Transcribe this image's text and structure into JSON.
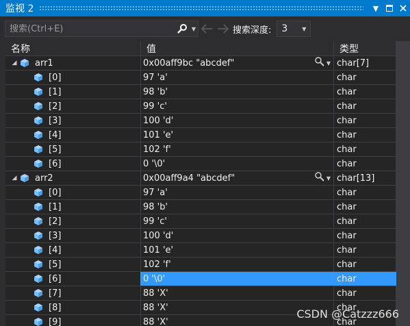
{
  "window": {
    "title": "监视 2"
  },
  "toolbar": {
    "search_placeholder": "搜索(Ctrl+E)",
    "depth_label": "搜索深度:",
    "depth_value": "3"
  },
  "columns": {
    "name": "名称",
    "value": "值",
    "type": "类型"
  },
  "rows": [
    {
      "name": "arr1",
      "value": "0x00aff9bc \"abcdef\"",
      "type": "char[7]",
      "level": 0,
      "expanded": true
    },
    {
      "name": "[0]",
      "value": "97 'a'",
      "type": "char",
      "level": 1
    },
    {
      "name": "[1]",
      "value": "98 'b'",
      "type": "char",
      "level": 1
    },
    {
      "name": "[2]",
      "value": "99 'c'",
      "type": "char",
      "level": 1
    },
    {
      "name": "[3]",
      "value": "100 'd'",
      "type": "char",
      "level": 1
    },
    {
      "name": "[4]",
      "value": "101 'e'",
      "type": "char",
      "level": 1
    },
    {
      "name": "[5]",
      "value": "102 'f'",
      "type": "char",
      "level": 1
    },
    {
      "name": "[6]",
      "value": "0 '\\0'",
      "type": "char",
      "level": 1
    },
    {
      "name": "arr2",
      "value": "0x00aff9a4 \"abcdef\"",
      "type": "char[13]",
      "level": 0,
      "expanded": true
    },
    {
      "name": "[0]",
      "value": "97 'a'",
      "type": "char",
      "level": 1
    },
    {
      "name": "[1]",
      "value": "98 'b'",
      "type": "char",
      "level": 1
    },
    {
      "name": "[2]",
      "value": "99 'c'",
      "type": "char",
      "level": 1
    },
    {
      "name": "[3]",
      "value": "100 'd'",
      "type": "char",
      "level": 1
    },
    {
      "name": "[4]",
      "value": "101 'e'",
      "type": "char",
      "level": 1
    },
    {
      "name": "[5]",
      "value": "102 'f'",
      "type": "char",
      "level": 1
    },
    {
      "name": "[6]",
      "value": "0 '\\0'",
      "type": "char",
      "level": 1,
      "selected": true
    },
    {
      "name": "[7]",
      "value": "88 'X'",
      "type": "char",
      "level": 1
    },
    {
      "name": "[8]",
      "value": "88 'X'",
      "type": "char",
      "level": 1
    },
    {
      "name": "[9]",
      "value": "88 'X'",
      "type": "char",
      "level": 1
    }
  ],
  "watermark": "CSDN @Catzzz666",
  "colors": {
    "accent": "#007acc",
    "selection": "#3399ff",
    "cube_icon": "#75beff",
    "background": "#252526"
  }
}
